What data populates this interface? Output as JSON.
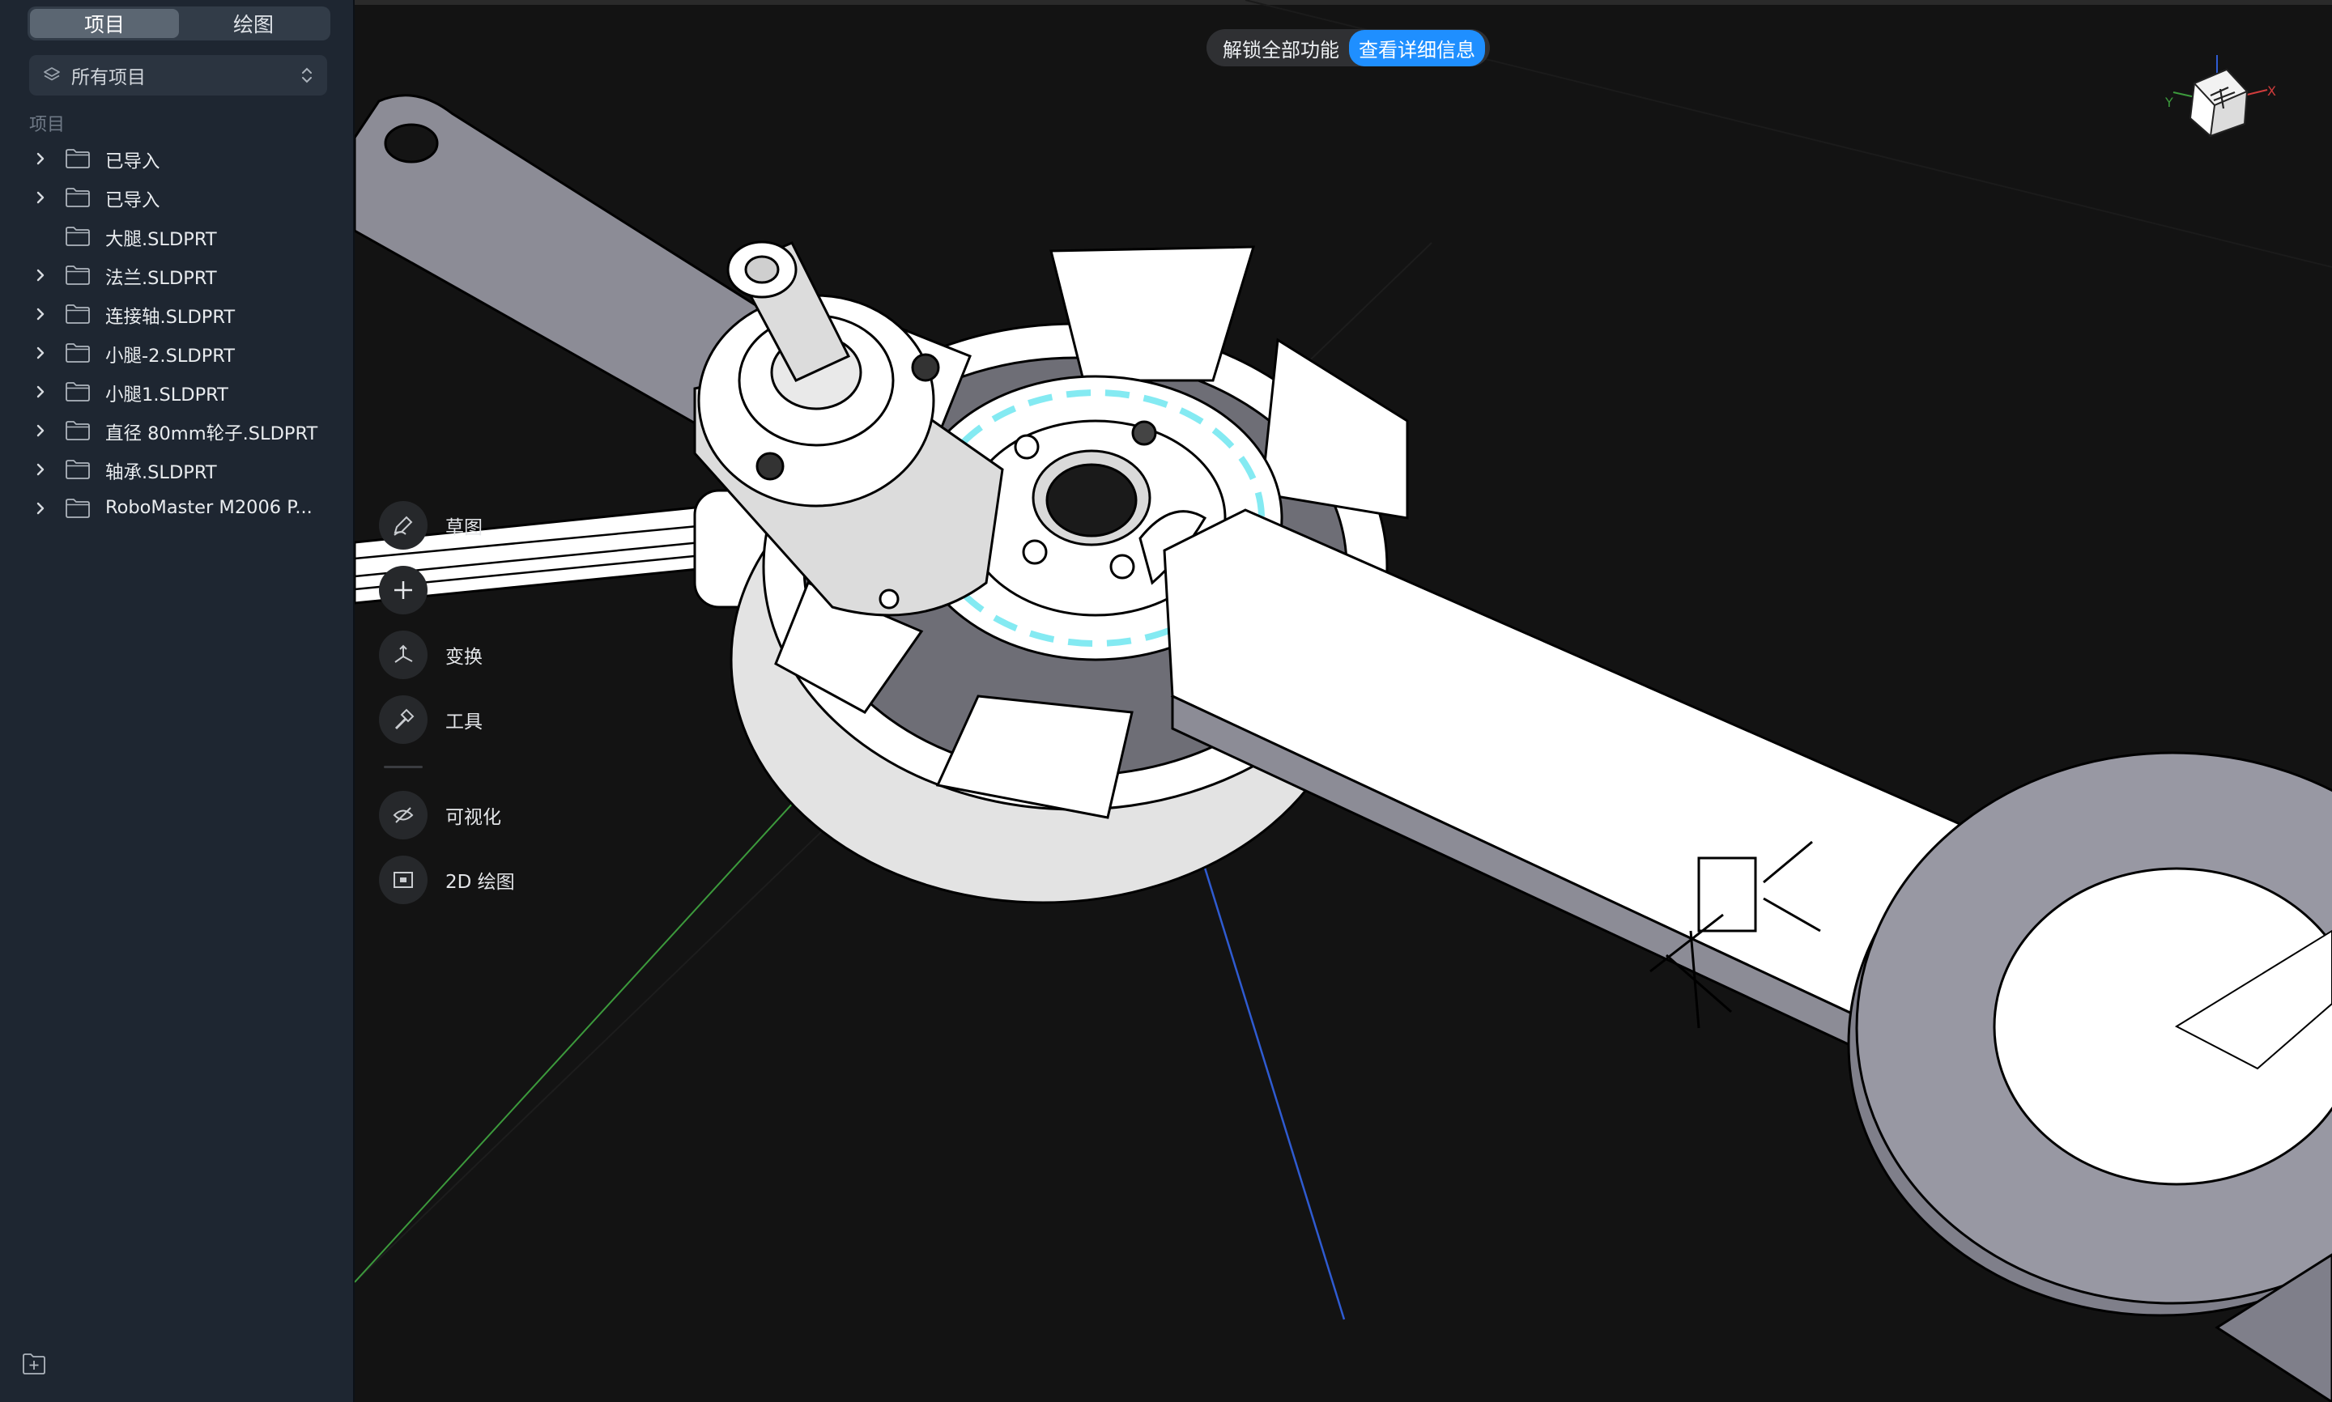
{
  "sidebar": {
    "tabs": [
      {
        "label": "项目",
        "active": true
      },
      {
        "label": "绘图",
        "active": false
      }
    ],
    "project_selector": {
      "label": "所有项目"
    },
    "section_label": "项目",
    "items": [
      {
        "name": "已导入",
        "expandable": true
      },
      {
        "name": "已导入",
        "expandable": true
      },
      {
        "name": "大腿.SLDPRT",
        "expandable": false
      },
      {
        "name": "法兰.SLDPRT",
        "expandable": true
      },
      {
        "name": "连接轴.SLDPRT",
        "expandable": true
      },
      {
        "name": "小腿-2.SLDPRT",
        "expandable": true
      },
      {
        "name": "小腿1.SLDPRT",
        "expandable": true
      },
      {
        "name": "直径 80mm轮子.SLDPRT",
        "expandable": true
      },
      {
        "name": "轴承.SLDPRT",
        "expandable": true
      },
      {
        "name": "RoboMaster M2006 P...",
        "expandable": true
      }
    ]
  },
  "banner": {
    "text": "解锁全部功能",
    "button": "查看详细信息"
  },
  "tools": [
    {
      "label": "草图",
      "icon": "pencil-sketch-icon"
    },
    {
      "label": "",
      "icon": "plus-icon"
    },
    {
      "label": "变换",
      "icon": "transform-icon"
    },
    {
      "label": "工具",
      "icon": "hammer-icon"
    },
    {
      "label": "可视化",
      "icon": "visualize-icon"
    },
    {
      "label": "2D 绘图",
      "icon": "drawing-2d-icon"
    }
  ],
  "colors": {
    "sidebar_bg": "#1e2631",
    "viewport_bg": "#131313",
    "accent": "#1f8fff",
    "axis_x": "#d03c3c",
    "axis_y": "#3c9a3c",
    "axis_z": "#2f5bd1"
  }
}
